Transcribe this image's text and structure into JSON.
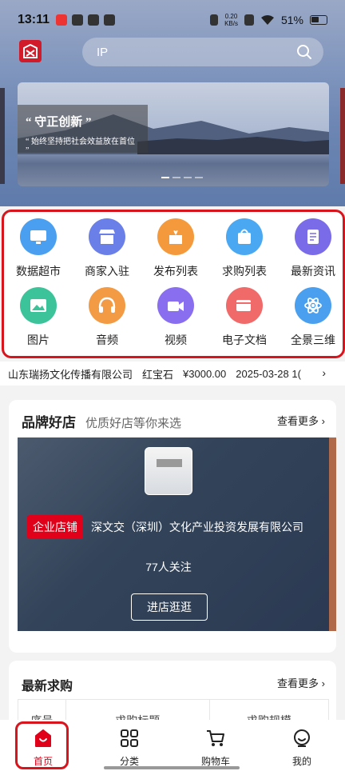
{
  "status_bar": {
    "time": "13:11",
    "speed_top": "0.20",
    "speed_bottom": "KB/s",
    "battery": "51%"
  },
  "header": {
    "search_placeholder": "IP"
  },
  "banner": {
    "title": "“ 守正创新 ”",
    "subtitle": "“ 始终坚持把社会效益放在首位 ”"
  },
  "categories": [
    {
      "label": "数据超市",
      "icon": "monitor-icon",
      "color": "#4a9ff0"
    },
    {
      "label": "商家入驻",
      "icon": "store-icon",
      "color": "#6b7fe8"
    },
    {
      "label": "发布列表",
      "icon": "gift-box-icon",
      "color": "#f59a3c"
    },
    {
      "label": "求购列表",
      "icon": "shopping-bag-icon",
      "color": "#4aa8f2"
    },
    {
      "label": "最新资讯",
      "icon": "news-icon",
      "color": "#7a6ce8"
    },
    {
      "label": "图片",
      "icon": "image-icon",
      "color": "#3cc39a"
    },
    {
      "label": "音频",
      "icon": "headphones-icon",
      "color": "#f39a45"
    },
    {
      "label": "视频",
      "icon": "video-camera-icon",
      "color": "#8a6ef0"
    },
    {
      "label": "电子文档",
      "icon": "document-icon",
      "color": "#f06a6a"
    },
    {
      "label": "全景三维",
      "icon": "atom-icon",
      "color": "#4aa0ee"
    }
  ],
  "ticker": {
    "company": "山东瑞扬文化传播有限公司",
    "item": "红宝石",
    "price": "¥3000.00",
    "date": "2025-03-28 1("
  },
  "brand_section": {
    "title": "品牌好店",
    "subtitle": "优质好店等你来选",
    "more": "查看更多",
    "store": {
      "tag": "企业店铺",
      "name": "深文交（深圳）文化产业投资发展有限公司",
      "followers": "77人关注",
      "enter_label": "进店逛逛"
    }
  },
  "wanted_section": {
    "title": "最新求购",
    "more": "查看更多",
    "columns": [
      "序号",
      "求购标题",
      "求购规模"
    ]
  },
  "tabbar": [
    {
      "label": "首页",
      "icon": "home-icon",
      "active": true
    },
    {
      "label": "分类",
      "icon": "grid-icon",
      "active": false
    },
    {
      "label": "购物车",
      "icon": "cart-icon",
      "active": false
    },
    {
      "label": "我的",
      "icon": "profile-icon",
      "active": false
    }
  ],
  "colors": {
    "accent": "#e0001a",
    "highlight_border": "#d8141c"
  }
}
